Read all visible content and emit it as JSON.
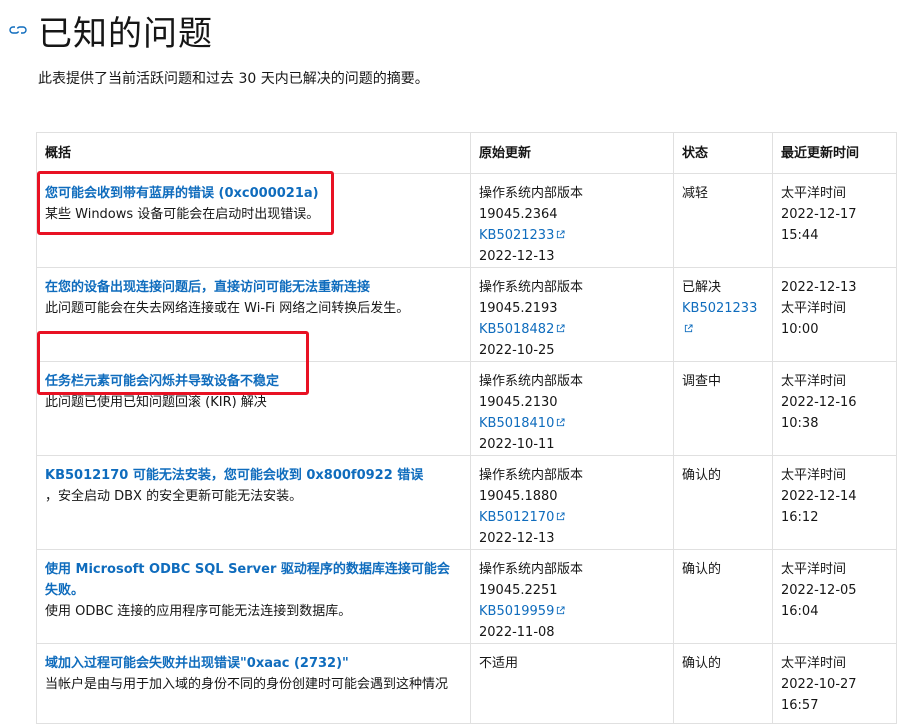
{
  "header": {
    "title": "已知的问题",
    "intro": "此表提供了当前活跃问题和过去 30 天内已解决的问题的摘要。"
  },
  "table": {
    "columns": [
      "概括",
      "原始更新",
      "状态",
      "最近更新时间"
    ],
    "rows": [
      {
        "title": "您可能会收到带有蓝屏的错误 (0xc000021a)",
        "desc": "某些 Windows 设备可能会在启动时出现错误。",
        "build": "操作系统内部版本 19045.2364",
        "kb": "KB5021233",
        "date": "2022-12-13",
        "status": "减轻",
        "status_kb": "",
        "updated": [
          "太平洋时间",
          "2022-12-17",
          "15:44"
        ]
      },
      {
        "title": "在您的设备出现连接问题后，直接访问可能无法重新连接",
        "desc": "此问题可能会在失去网络连接或在 Wi-Fi 网络之间转换后发生。",
        "build": "操作系统内部版本 19045.2193",
        "kb": "KB5018482",
        "date": "2022-10-25",
        "status": "已解决",
        "status_kb": "KB5021233",
        "updated": [
          "2022-12-13",
          "太平洋时间",
          "10:00"
        ]
      },
      {
        "title": "任务栏元素可能会闪烁并导致设备不稳定",
        "desc": "此问题已使用已知问题回滚 (KIR) 解决",
        "build": "操作系统内部版本 19045.2130",
        "kb": "KB5018410",
        "date": "2022-10-11",
        "status": "调查中",
        "status_kb": "",
        "updated": [
          "太平洋时间",
          "2022-12-16",
          "10:38"
        ]
      },
      {
        "title": "KB5012170 可能无法安装，您可能会收到 0x800f0922 错误",
        "desc": "，安全启动 DBX 的安全更新可能无法安装。",
        "build": "操作系统内部版本 19045.1880",
        "kb": "KB5012170",
        "date": "2022-12-13",
        "status": "确认的",
        "status_kb": "",
        "updated": [
          "太平洋时间",
          "2022-12-14",
          "16:12"
        ]
      },
      {
        "title": "使用 Microsoft ODBC SQL Server 驱动程序的数据库连接可能会失败。",
        "desc": "使用 ODBC 连接的应用程序可能无法连接到数据库。",
        "build": "操作系统内部版本 19045.2251",
        "kb": "KB5019959",
        "date": "2022-11-08",
        "status": "确认的",
        "status_kb": "",
        "updated": [
          "太平洋时间",
          "2022-12-05",
          "16:04"
        ]
      },
      {
        "title": "域加入过程可能会失败并出现错误\"0xaac (2732)\"",
        "desc": "当帐户是由与用于加入域的身份不同的身份创建时可能会遇到这种情况",
        "build": "不适用",
        "kb": "",
        "date": "",
        "status": "确认的",
        "status_kb": "",
        "updated": [
          "太平洋时间",
          "2022-10-27",
          "16:57"
        ]
      }
    ]
  },
  "highlight_color": "#e81123",
  "link_color": "#0f6cbd",
  "icons": [
    "link-icon",
    "external-link-icon"
  ]
}
